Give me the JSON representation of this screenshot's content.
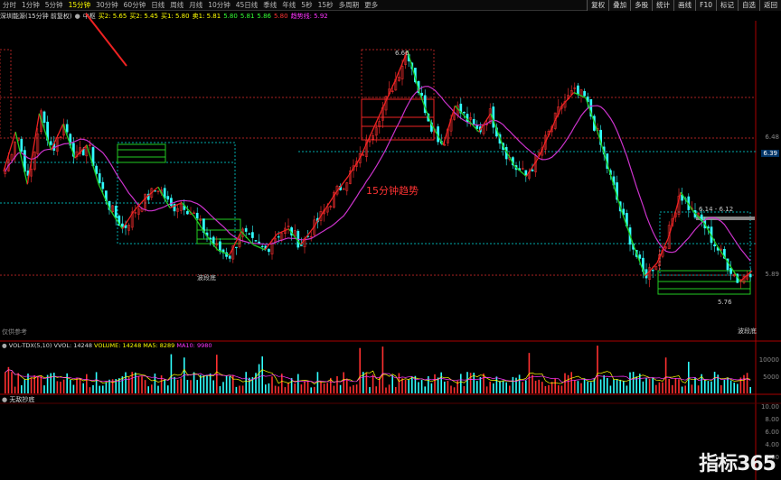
{
  "top_tabs": [
    "分时",
    "1分钟",
    "5分钟",
    "15分钟",
    "30分钟",
    "60分钟",
    "日线",
    "周线",
    "月线",
    "10分钟",
    "45日线",
    "季线",
    "年线",
    "5秒",
    "15秒",
    "多周期",
    "更多"
  ],
  "active_tab_index": 3,
  "right_buttons": [
    "复权",
    "叠加",
    "多股",
    "统计",
    "画线",
    "F10",
    "标记",
    "自选",
    "返回"
  ],
  "info": {
    "title": "深圳能源(15分钟 前复权)",
    "checkbox_label": "中枢",
    "s1": "买2: 5.65",
    "s2": "买2: 5.45",
    "s3": "买1: 5.80",
    "s4": "卖1: 5.81",
    "s5": "5.80",
    "s6": "5.81",
    "s7": "5.86",
    "s8": "5.80",
    "s9": "趋势线: 5.92"
  },
  "annotations": {
    "trend_label": "15分钟趋势",
    "high_label": "6.66",
    "zone_label": "6.14 - 6.12",
    "low_label": "5.76",
    "wave_bottom_1": "波段底",
    "wave_bottom_2": "波段底",
    "footer_note": "仅供参考"
  },
  "price_axis": {
    "labels": [
      "6.48",
      "6.39",
      "5.89"
    ],
    "current": "6.39"
  },
  "volume_header": {
    "name": "VOL-TDX(5,10)",
    "vvol": "VVOL: 14248",
    "volume": "VOLUME: 14248",
    "ma5": "MA5: 8289",
    "ma10": "MA10: 9980"
  },
  "volume_axis": [
    "10000",
    "5000"
  ],
  "indicator_header": "无敌抄底",
  "indicator_axis": [
    "10.00",
    "8.00",
    "6.00",
    "4.00",
    "2.00"
  ],
  "watermark": "指标365",
  "colors": {
    "up": "#ff3030",
    "down": "#30ffff",
    "ma": "#cc33cc",
    "green_line": "#22cc22",
    "red_line": "#ee2222"
  },
  "chart_data": {
    "type": "candlestick",
    "close_path": [
      6.2,
      6.35,
      6.15,
      6.42,
      6.28,
      6.38,
      6.25,
      6.3,
      6.15,
      6.05,
      5.98,
      6.05,
      6.1,
      6.14,
      6.06,
      6.08,
      6.03,
      5.96,
      5.9,
      5.88,
      5.97,
      5.92,
      5.9,
      5.96,
      5.98,
      5.92,
      5.98,
      6.05,
      6.12,
      6.18,
      6.25,
      6.35,
      6.45,
      6.55,
      6.66,
      6.5,
      6.38,
      6.3,
      6.45,
      6.4,
      6.35,
      6.42,
      6.3,
      6.22,
      6.18,
      6.25,
      6.35,
      6.45,
      6.5,
      6.48,
      6.35,
      6.2,
      6.05,
      5.92,
      5.8,
      5.85,
      5.95,
      6.12,
      6.05,
      6.0,
      5.92,
      5.85,
      5.78,
      5.82
    ]
  }
}
